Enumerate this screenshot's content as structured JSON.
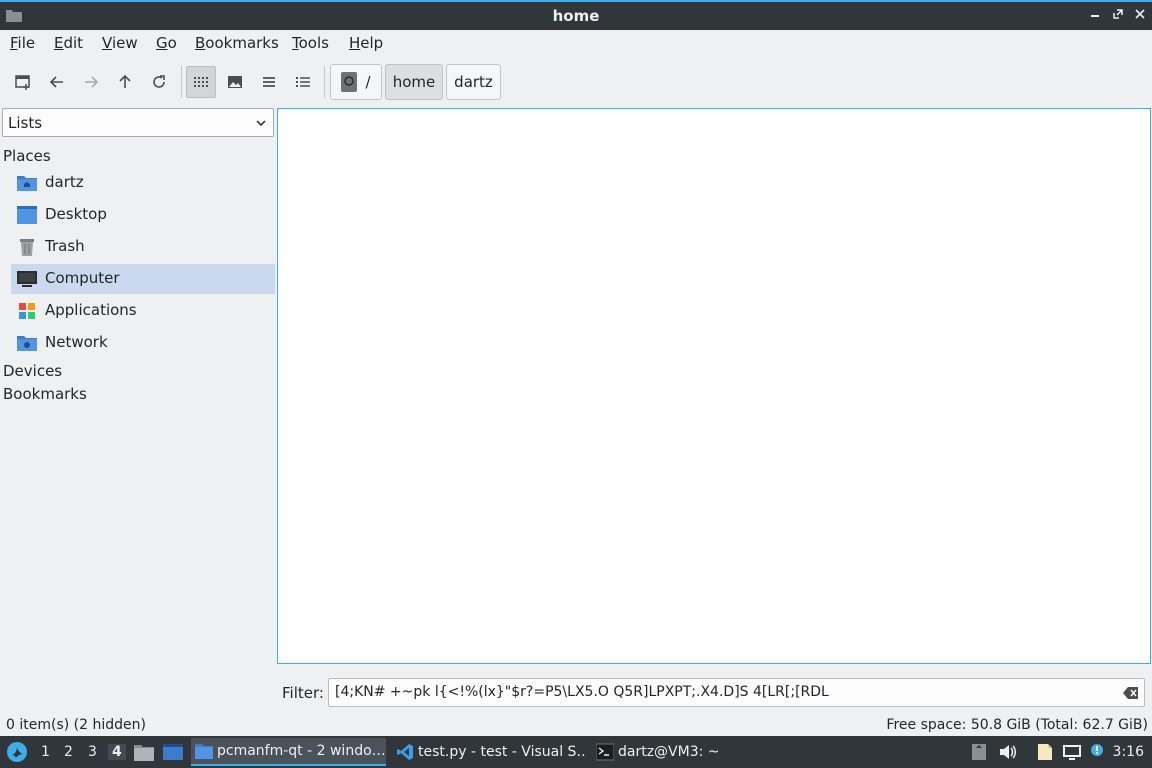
{
  "window": {
    "title": "home"
  },
  "menu": [
    {
      "pre": "",
      "acc": "F",
      "post": "ile"
    },
    {
      "pre": "",
      "acc": "E",
      "post": "dit"
    },
    {
      "pre": "",
      "acc": "V",
      "post": "iew"
    },
    {
      "pre": "",
      "acc": "G",
      "post": "o"
    },
    {
      "pre": "",
      "acc": "B",
      "post": "ookmarks"
    },
    {
      "pre": "",
      "acc": "T",
      "post": "ools"
    },
    {
      "pre": "",
      "acc": "H",
      "post": "elp"
    }
  ],
  "breadcrumb": {
    "root": "/",
    "items": [
      "home",
      "dartz"
    ]
  },
  "side": {
    "mode": "Lists",
    "places_heading": "Places",
    "places": [
      "dartz",
      "Desktop",
      "Trash",
      "Computer",
      "Applications",
      "Network"
    ],
    "selected": "Computer",
    "devices_heading": "Devices",
    "bookmarks_heading": "Bookmarks"
  },
  "filter": {
    "label": "Filter:",
    "value": "[4;KN# +~pk l{<!%(lx}\"$r?=P5\\LX5.O Q5R]LPXPT;.X4.D]S 4[LR[;[RDL"
  },
  "status": {
    "items": "0 item(s) (2 hidden)",
    "free": "Free space: 50.8 GiB (Total: 62.7 GiB)"
  },
  "taskbar": {
    "desktops": [
      "1",
      "2",
      "3",
      "4"
    ],
    "active_desktop": "4",
    "windows": [
      "pcmanfm-qt - 2 windo…",
      "test.py - test - Visual S…",
      "dartz@VM3: ~"
    ],
    "clock": "3:16"
  },
  "colors": {
    "accent": "#3daee9",
    "panel": "#31363b",
    "selection": "#cad9ee"
  }
}
